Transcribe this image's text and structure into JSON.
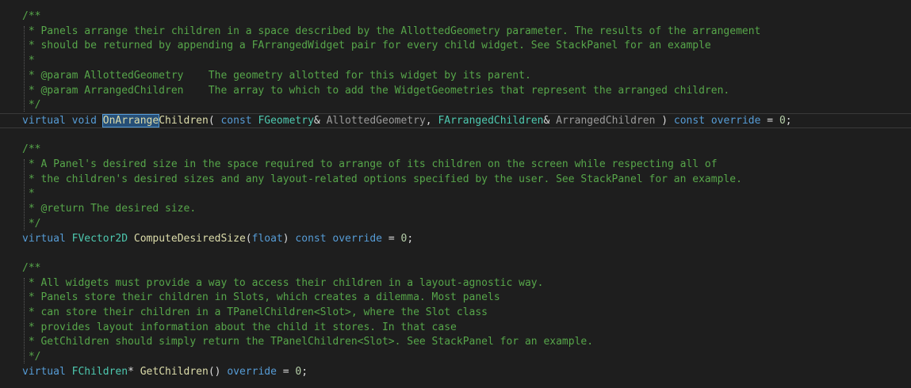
{
  "colors": {
    "background": "#1e1e1e",
    "comment": "#57a64a",
    "keyword": "#569cd6",
    "type": "#4ec9b0",
    "function": "#dcdcaa",
    "parameter": "#9a9a9a",
    "plain": "#dcdcdc",
    "number": "#b5cea8"
  },
  "code_lines": [
    {
      "indent": 28,
      "tokens": [
        {
          "c": "comment",
          "t": "/**"
        }
      ]
    },
    {
      "indent": 28,
      "tokens": [
        {
          "c": "comment",
          "t": " * Panels arrange their children in a space described by the AllottedGeometry parameter. The results of the arrangement"
        }
      ]
    },
    {
      "indent": 28,
      "tokens": [
        {
          "c": "comment",
          "t": " * should be returned by appending a FArrangedWidget pair for every child widget. See StackPanel for an example"
        }
      ]
    },
    {
      "indent": 28,
      "tokens": [
        {
          "c": "comment",
          "t": " *"
        }
      ]
    },
    {
      "indent": 28,
      "tokens": [
        {
          "c": "comment",
          "t": " * @param AllottedGeometry    The geometry allotted for this widget by its parent."
        }
      ]
    },
    {
      "indent": 28,
      "tokens": [
        {
          "c": "comment",
          "t": " * @param ArrangedChildren    The array to which to add the WidgetGeometries that represent the arranged children."
        }
      ]
    },
    {
      "indent": 28,
      "tokens": [
        {
          "c": "comment",
          "t": " */"
        }
      ]
    },
    {
      "indent": 28,
      "current": true,
      "tokens": [
        {
          "c": "keyword",
          "t": "virtual void "
        },
        {
          "c": "func",
          "t": "OnArrange",
          "highlight": true
        },
        {
          "c": "func",
          "t": "Children"
        },
        {
          "c": "plain",
          "t": "( "
        },
        {
          "c": "keyword",
          "t": "const "
        },
        {
          "c": "type",
          "t": "FGeometry"
        },
        {
          "c": "plain",
          "t": "& "
        },
        {
          "c": "param",
          "t": "AllottedGeometry"
        },
        {
          "c": "plain",
          "t": ", "
        },
        {
          "c": "type",
          "t": "FArrangedChildren"
        },
        {
          "c": "plain",
          "t": "& "
        },
        {
          "c": "param",
          "t": "ArrangedChildren"
        },
        {
          "c": "plain",
          "t": " ) "
        },
        {
          "c": "keyword",
          "t": "const override"
        },
        {
          "c": "plain",
          "t": " = "
        },
        {
          "c": "number",
          "t": "0"
        },
        {
          "c": "plain",
          "t": ";"
        }
      ]
    },
    {
      "indent": 28,
      "tokens": []
    },
    {
      "indent": 28,
      "tokens": [
        {
          "c": "comment",
          "t": "/**"
        }
      ]
    },
    {
      "indent": 28,
      "tokens": [
        {
          "c": "comment",
          "t": " * A Panel's desired size in the space required to arrange of its children on the screen while respecting all of"
        }
      ]
    },
    {
      "indent": 28,
      "tokens": [
        {
          "c": "comment",
          "t": " * the children's desired sizes and any layout-related options specified by the user. See StackPanel for an example."
        }
      ]
    },
    {
      "indent": 28,
      "tokens": [
        {
          "c": "comment",
          "t": " *"
        }
      ]
    },
    {
      "indent": 28,
      "tokens": [
        {
          "c": "comment",
          "t": " * @return The desired size."
        }
      ]
    },
    {
      "indent": 28,
      "tokens": [
        {
          "c": "comment",
          "t": " */"
        }
      ]
    },
    {
      "indent": 28,
      "tokens": [
        {
          "c": "keyword",
          "t": "virtual "
        },
        {
          "c": "type",
          "t": "FVector2D "
        },
        {
          "c": "func",
          "t": "ComputeDesiredSize"
        },
        {
          "c": "plain",
          "t": "("
        },
        {
          "c": "keyword",
          "t": "float"
        },
        {
          "c": "plain",
          "t": ") "
        },
        {
          "c": "keyword",
          "t": "const override"
        },
        {
          "c": "plain",
          "t": " = "
        },
        {
          "c": "number",
          "t": "0"
        },
        {
          "c": "plain",
          "t": ";"
        }
      ]
    },
    {
      "indent": 28,
      "tokens": []
    },
    {
      "indent": 28,
      "tokens": [
        {
          "c": "comment",
          "t": "/**"
        }
      ]
    },
    {
      "indent": 28,
      "tokens": [
        {
          "c": "comment",
          "t": " * All widgets must provide a way to access their children in a layout-agnostic way."
        }
      ]
    },
    {
      "indent": 28,
      "tokens": [
        {
          "c": "comment",
          "t": " * Panels store their children in Slots, which creates a dilemma. Most panels"
        }
      ]
    },
    {
      "indent": 28,
      "tokens": [
        {
          "c": "comment",
          "t": " * can store their children in a TPanelChildren<Slot>, where the Slot class"
        }
      ]
    },
    {
      "indent": 28,
      "tokens": [
        {
          "c": "comment",
          "t": " * provides layout information about the child it stores. In that case"
        }
      ]
    },
    {
      "indent": 28,
      "tokens": [
        {
          "c": "comment",
          "t": " * GetChildren should simply return the TPanelChildren<Slot>. See StackPanel for an example."
        }
      ]
    },
    {
      "indent": 28,
      "tokens": [
        {
          "c": "comment",
          "t": " */"
        }
      ]
    },
    {
      "indent": 28,
      "tokens": [
        {
          "c": "keyword",
          "t": "virtual "
        },
        {
          "c": "type",
          "t": "FChildren"
        },
        {
          "c": "plain",
          "t": "* "
        },
        {
          "c": "func",
          "t": "GetChildren"
        },
        {
          "c": "plain",
          "t": "() "
        },
        {
          "c": "keyword",
          "t": "override"
        },
        {
          "c": "plain",
          "t": " = "
        },
        {
          "c": "number",
          "t": "0"
        },
        {
          "c": "plain",
          "t": ";"
        }
      ]
    }
  ]
}
